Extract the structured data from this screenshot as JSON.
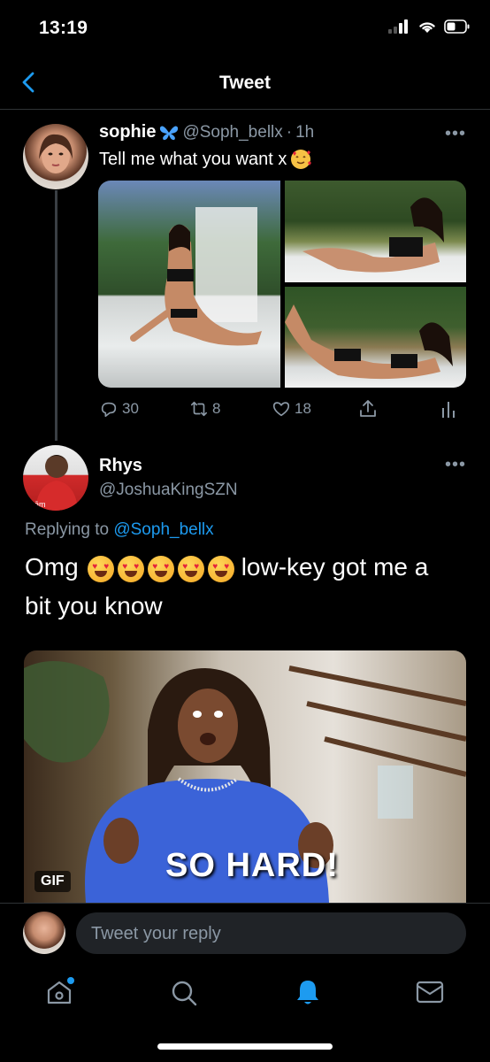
{
  "status": {
    "time": "13:19"
  },
  "nav": {
    "title": "Tweet"
  },
  "tweet": {
    "display_name": "sophie",
    "handle": "@Soph_bellx",
    "separator": "·",
    "time": "1h",
    "text": "Tell me what you want x",
    "actions": {
      "replies": "30",
      "retweets": "8",
      "likes": "18"
    }
  },
  "reply": {
    "display_name": "Rhys",
    "handle": "@JoshuaKingSZN",
    "replying_prefix": "Replying to",
    "replying_to": "@Soph_bellx",
    "text_before": "Omg",
    "text_after": "low-key got me a",
    "text_line2": "bit you know",
    "gif_badge": "GIF",
    "gif_caption": "SO HARD!"
  },
  "composer": {
    "placeholder": "Tweet your reply"
  },
  "colors": {
    "accent": "#1d9bf0",
    "muted": "#8b98a5",
    "background": "#000000"
  },
  "icons": [
    "back-icon",
    "signal-icon",
    "wifi-icon",
    "battery-icon",
    "butterfly-icon",
    "smiling-hearts-emoji",
    "reply-icon",
    "retweet-icon",
    "like-icon",
    "share-icon",
    "analytics-icon",
    "more-icon",
    "heart-eyes-emoji",
    "home-icon",
    "search-icon",
    "notifications-icon",
    "messages-icon"
  ]
}
